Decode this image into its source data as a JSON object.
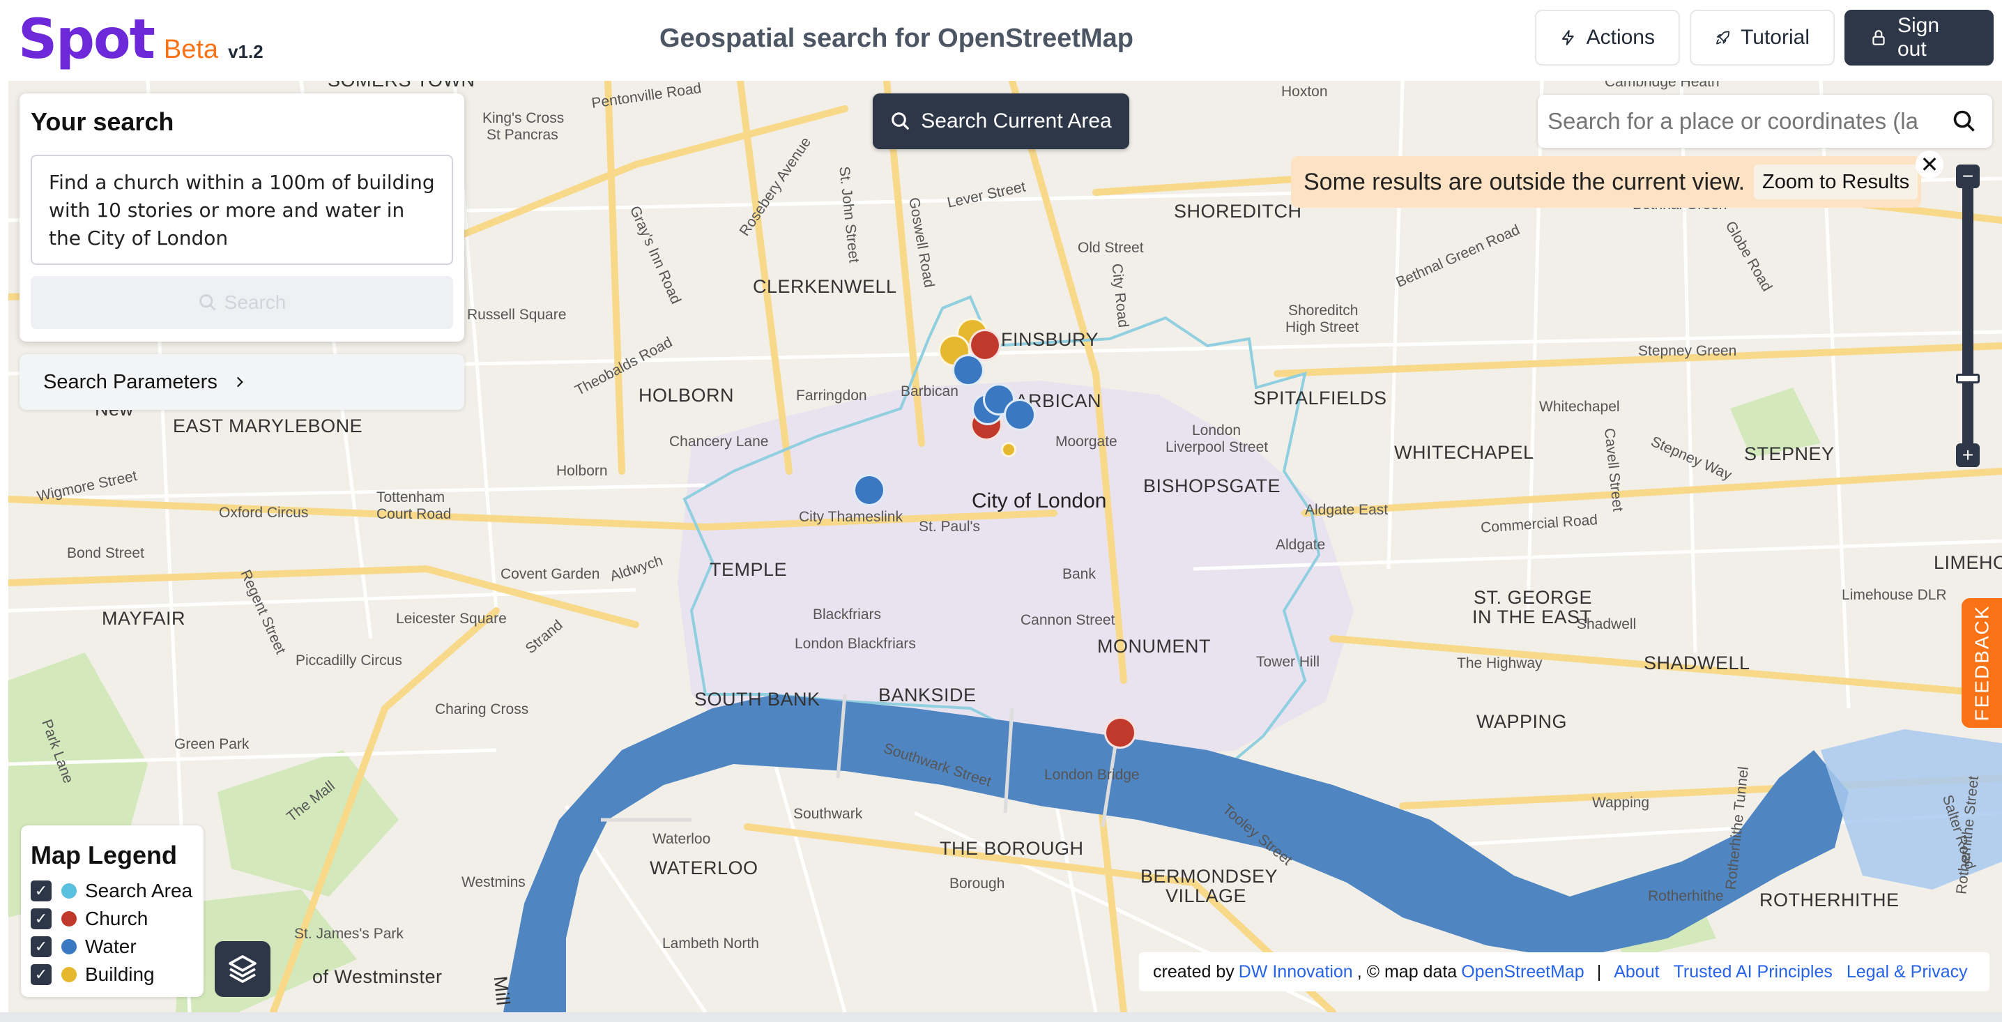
{
  "header": {
    "logo": "Spot",
    "logo_badge": "Beta",
    "version": "v1.2",
    "title": "Geospatial search for OpenStreetMap",
    "actions_label": "Actions",
    "tutorial_label": "Tutorial",
    "signout_label": "Sign out"
  },
  "search_panel": {
    "heading": "Your search",
    "query": "Find a church within a 100m of building with 10 stories or more and water in the City of London",
    "search_label": "Search",
    "params_label": "Search Parameters"
  },
  "map_controls": {
    "search_area_label": "Search Current Area",
    "place_placeholder": "Search for a place or coordinates (la",
    "notice_text": "Some results are outside the current view.",
    "zoom_results_label": "Zoom to Results",
    "zoom_in": "+",
    "zoom_out": "−",
    "feedback_label": "FEEDBACK"
  },
  "legend": {
    "title": "Map Legend",
    "items": [
      {
        "label": "Search Area",
        "color": "#5bc0de",
        "checked": true
      },
      {
        "label": "Church",
        "color": "#c0392b",
        "checked": true
      },
      {
        "label": "Water",
        "color": "#3a78c2",
        "checked": true
      },
      {
        "label": "Building",
        "color": "#e6b82e",
        "checked": true
      }
    ]
  },
  "attribution": {
    "created_by": "created by",
    "company": "DW Innovation",
    "map_data": ", © map data",
    "osm": "OpenStreetMap",
    "links": [
      "About",
      "Trusted AI Principles",
      "Legal & Privacy"
    ]
  },
  "map_labels": {
    "somers_town": "SOMERS TOWN",
    "pentonville_road": "Pentonville Road",
    "kings_cross": "King's Cross",
    "st_pancras": "St Pancras",
    "goswell_road": "Goswell Road",
    "lever_street": "Lever Street",
    "old_street": "Old Street",
    "shoreditch": "SHOREDITCH",
    "hoxton": "Hoxton",
    "cambridge_heath": "Cambridge Heath",
    "bethnal_green": "Bethnal Green",
    "bethnal_green_road": "Bethnal Green Road",
    "globe_road": "Globe Road",
    "st_john_street": "St. John Street",
    "rosebery_avenue": "Rosebery Avenue",
    "grays_inn_road": "Gray's Inn Road",
    "clerkenwell": "CLERKENWELL",
    "finsbury": "FINSBURY",
    "city_road": "City Road",
    "shoreditch_high_street": "Shoreditch",
    "high_street": "High Street",
    "stepney_green": "Stepney Green",
    "russell_square": "Russell Square",
    "theobalds_road": "Theobalds Road",
    "holborn_caps": "HOLBORN",
    "farringdon": "Farringdon",
    "barbican_station": "Barbican",
    "barbican": "BARBICAN",
    "spitalfields": "SPITALFIELDS",
    "whitechapel_station": "Whitechapel",
    "east_marylebone": "EAST MARYLEBONE",
    "chancery_lane": "Chancery Lane",
    "moorgate": "Moorgate",
    "london_liverpool": "London",
    "liverpool_street": "Liverpool Street",
    "whitechapel": "WHITECHAPEL",
    "cavell_street": "Cavell Street",
    "stepney_way": "Stepney Way",
    "stepney": "STEPNEY",
    "wigmore_street": "Wigmore Street",
    "tottenham": "Tottenham",
    "court_road": "Court Road",
    "holborn_station": "Holborn",
    "city_of_london": "City of London",
    "bishopsgate": "BISHOPSGATE",
    "oxford_circus": "Oxford Circus",
    "city_thameslink": "City Thameslink",
    "st_pauls": "St. Paul's",
    "aldgate_east": "Aldgate East",
    "commercial_road": "Commercial Road",
    "bond_street": "Bond Street",
    "regent_street": "Regent Street",
    "aldwych": "Aldwych",
    "temple": "TEMPLE",
    "aldgate": "Aldgate",
    "limehouse": "LIMEHOU",
    "covent_garden": "Covent Garden",
    "bank": "Bank",
    "limehouse_dlr": "Limehouse DLR",
    "mayfair": "MAYFAIR",
    "leicester_square": "Leicester Square",
    "blackfriars": "Blackfriars",
    "cannon_street": "Cannon Street",
    "monument": "MONUMENT",
    "st_george": "ST. GEORGE",
    "in_the_east": "IN THE EAST",
    "shadwell_station": "Shadwell",
    "piccadilly_circus": "Piccadilly Circus",
    "strand": "Strand",
    "london_blackfriars": "London Blackfriars",
    "tower_hill": "Tower Hill",
    "the_highway": "The Highway",
    "shadwell": "SHADWELL",
    "south_bank": "SOUTH BANK",
    "bankside": "BANKSIDE",
    "charing_cross": "Charing Cross",
    "park_lane": "Park Lane",
    "green_park": "Green Park",
    "wapping": "WAPPING",
    "southwark_street": "Southwark Street",
    "london_bridge": "London Bridge",
    "the_mall": "The Mall",
    "southwark": "Southwark",
    "tooley_street": "Tooley Street",
    "wapping_station": "Wapping",
    "rotherhithe_tunnel": "Rotherhithe Tunnel",
    "rotherhithe_street": "Rotherhithe Street",
    "salter_road": "Salter Road",
    "waterloo_station": "Waterloo",
    "the_borough": "THE BOROUGH",
    "waterloo": "WATERLOO",
    "bermondsey": "BERMONDSEY",
    "village": "VILLAGE",
    "westminster_station": "Westmins",
    "borough": "Borough",
    "rotherhithe_station": "Rotherhithe",
    "rotherhithe": "ROTHERHITHE",
    "st_james_park": "St. James's Park",
    "lambeth_north": "Lambeth North",
    "westminster": "of Westminster",
    "new": "New",
    "mill": "Mill"
  }
}
